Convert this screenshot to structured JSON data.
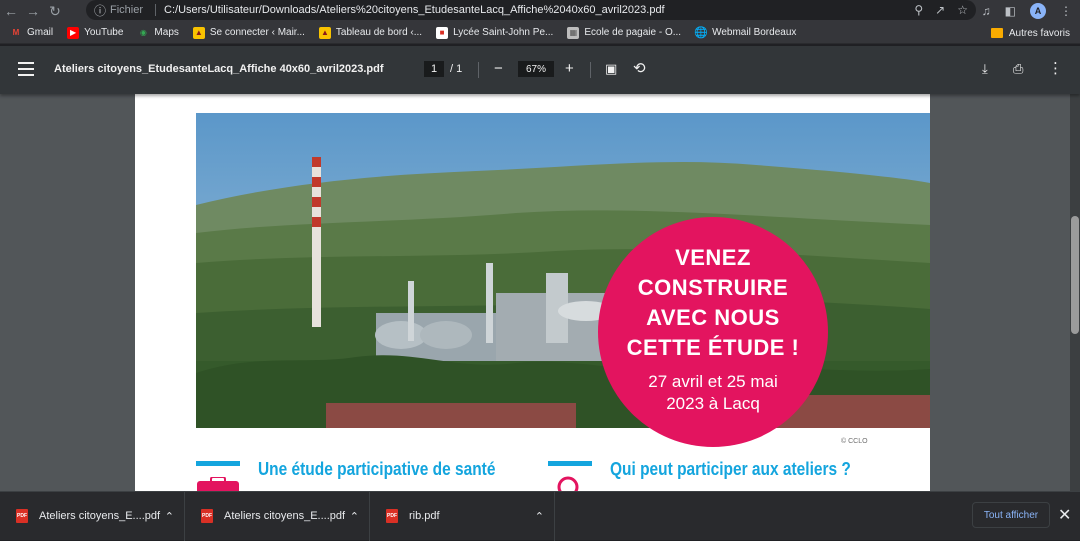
{
  "browser": {
    "scheme_label": "Fichier",
    "url": "C:/Users/Utilisateur/Downloads/Ateliers%20citoyens_EtudesanteLacq_Affiche%2040x60_avril2023.pdf",
    "avatar_letter": "A"
  },
  "bookmarks": {
    "items": [
      {
        "label": "Gmail",
        "icon": "gmail-icon",
        "color": "#ea4335"
      },
      {
        "label": "YouTube",
        "icon": "youtube-icon",
        "color": "#ff0000"
      },
      {
        "label": "Maps",
        "icon": "maps-icon",
        "color": "#34a853"
      },
      {
        "label": "Se connecter ‹ Mair...",
        "icon": "crest-icon",
        "color": "#f9c300"
      },
      {
        "label": "Tableau de bord ‹...",
        "icon": "crest-icon",
        "color": "#f9c300"
      },
      {
        "label": "Lycée Saint-John Pe...",
        "icon": "school-icon",
        "color": "#ffffff"
      },
      {
        "label": "Ecole de pagaie - O...",
        "icon": "image-icon",
        "color": "#bdbdbd"
      },
      {
        "label": "Webmail Bordeaux",
        "icon": "globe-icon",
        "color": "#bdc1c6"
      }
    ],
    "other_label": "Autres favoris"
  },
  "pdf_toolbar": {
    "title": "Ateliers citoyens_EtudesanteLacq_Affiche 40x60_avril2023.pdf",
    "current_page": "1",
    "total_pages": "/ 1",
    "zoom": "67%"
  },
  "poster": {
    "badge_lines": [
      "VENEZ",
      "CONSTRUIRE",
      "AVEC NOUS",
      "CETTE ÉTUDE !"
    ],
    "badge_date_lines": [
      "27 avril et 25 mai",
      "2023 à Lacq"
    ],
    "photo_credit": "© CCLO",
    "section_left_title": "Une étude participative de santé",
    "section_right_title": "Qui peut participer aux ateliers ?",
    "accent_color": "#e3145f",
    "section_color": "#14a5de"
  },
  "downloads": {
    "items": [
      {
        "name": "Ateliers citoyens_E....pdf"
      },
      {
        "name": "Ateliers citoyens_E....pdf"
      },
      {
        "name": "rib.pdf"
      }
    ],
    "show_all_label": "Tout afficher"
  }
}
